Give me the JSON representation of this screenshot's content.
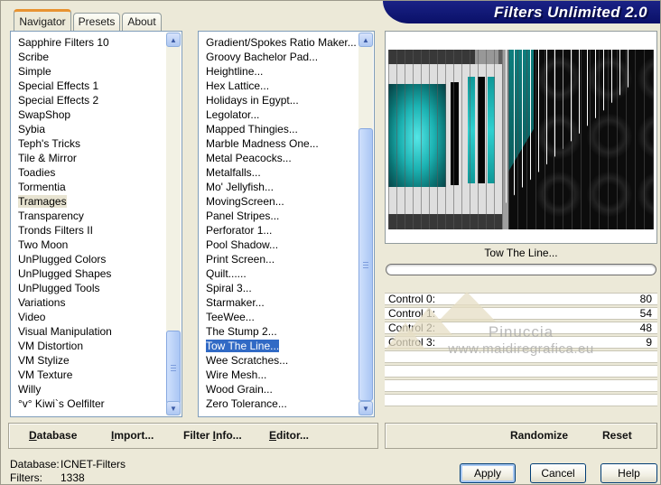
{
  "banner": {
    "title": "Filters Unlimited 2.0"
  },
  "tabs": [
    {
      "label": "Navigator",
      "active": true
    },
    {
      "label": "Presets",
      "active": false
    },
    {
      "label": "About",
      "active": false
    }
  ],
  "category_list": {
    "highlighted": "Tramages",
    "items": [
      "Sapphire Filters 10",
      "Scribe",
      "Simple",
      "Special Effects 1",
      "Special Effects 2",
      "SwapShop",
      "Sybia",
      "Teph's Tricks",
      "Tile & Mirror",
      "Toadies",
      "Tormentia",
      "Tramages",
      "Transparency",
      "Tronds Filters II",
      "Two Moon",
      "UnPlugged Colors",
      "UnPlugged Shapes",
      "UnPlugged Tools",
      "Variations",
      "Video",
      "Visual Manipulation",
      "VM Distortion",
      "VM Stylize",
      "VM Texture",
      "Willy",
      "°v° Kiwi`s Oelfilter"
    ]
  },
  "filter_list": {
    "selected": "Tow The Line...",
    "items": [
      "Gradient/Spokes Ratio Maker...",
      "Groovy Bachelor Pad...",
      "Heightline...",
      "Hex Lattice...",
      "Holidays in Egypt...",
      "Legolator...",
      "Mapped Thingies...",
      "Marble Madness One...",
      "Metal Peacocks...",
      "Metalfalls...",
      "Mo' Jellyfish...",
      "MovingScreen...",
      "Panel Stripes...",
      "Perforator 1...",
      "Pool Shadow...",
      "Print Screen...",
      "Quilt......",
      "Spiral 3...",
      "Starmaker...",
      "TeeWee...",
      "The Stump 2...",
      "Tow The Line...",
      "Wee Scratches...",
      "Wire Mesh...",
      "Wood Grain...",
      "Zero Tolerance..."
    ]
  },
  "preview": {
    "filter_name": "Tow The Line...",
    "progress_value": 0,
    "empty_rows": 4,
    "watermark_line1": "Pinuccia",
    "watermark_line2": "www.maidiregrafica.eu"
  },
  "controls": [
    {
      "label": "Control 0:",
      "value": "80"
    },
    {
      "label": "Control 1:",
      "value": "54"
    },
    {
      "label": "Control 2:",
      "value": "48"
    },
    {
      "label": "Control 3:",
      "value": "9"
    }
  ],
  "command_bar": {
    "database": {
      "pre": "",
      "u": "D",
      "post": "atabase"
    },
    "import": {
      "pre": "",
      "u": "I",
      "post": "mport..."
    },
    "filter_info": {
      "pre": "Filter ",
      "u": "I",
      "post": "nfo..."
    },
    "editor": {
      "pre": "",
      "u": "E",
      "post": "ditor..."
    },
    "randomize": "Randomize",
    "reset": "Reset"
  },
  "status": {
    "database_label": "Database:",
    "database_value": "ICNET-Filters",
    "filters_label": "Filters:",
    "filters_value": "1338"
  },
  "footer": {
    "apply": "Apply",
    "cancel": "Cancel",
    "help": "Help"
  },
  "colors": {
    "dialog_beige": "#ece9d8",
    "banner_navy": "#0c1273",
    "tab_orange": "#e89331",
    "selection_blue": "#316ac5",
    "preview_teal": "#2fd0d0",
    "scrollbar_blue": "#aac6f4"
  }
}
